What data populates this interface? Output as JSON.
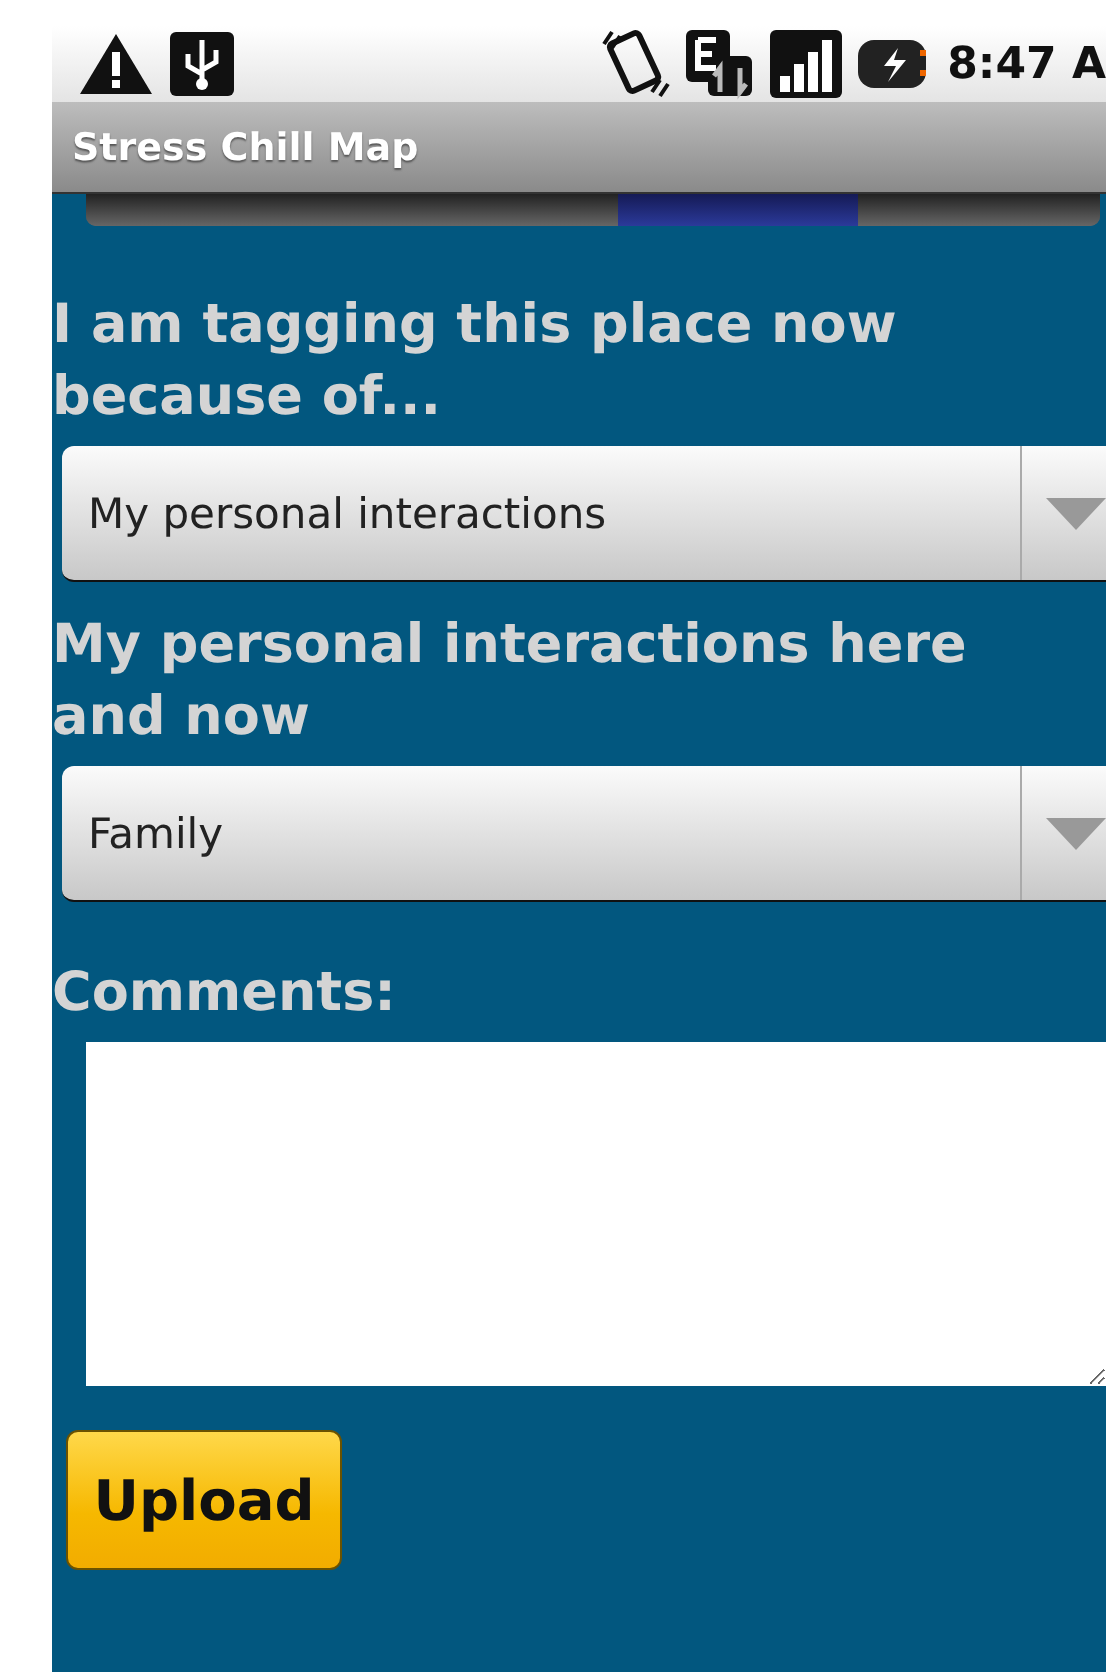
{
  "status_bar": {
    "time": "8:47 A"
  },
  "window": {
    "title": "Stress Chill Map"
  },
  "page_indicator": [
    {
      "selected": false
    },
    {
      "selected": true
    },
    {
      "selected": false
    }
  ],
  "form": [
    {
      "kind": "spinner",
      "label": "I am tagging this place now because of...",
      "value": "My personal interactions"
    },
    {
      "kind": "spinner",
      "label": "My personal interactions here and now",
      "value": "Family"
    },
    {
      "kind": "textarea",
      "label": "Comments:"
    }
  ],
  "buttons": [
    {
      "label": "Upload"
    }
  ]
}
